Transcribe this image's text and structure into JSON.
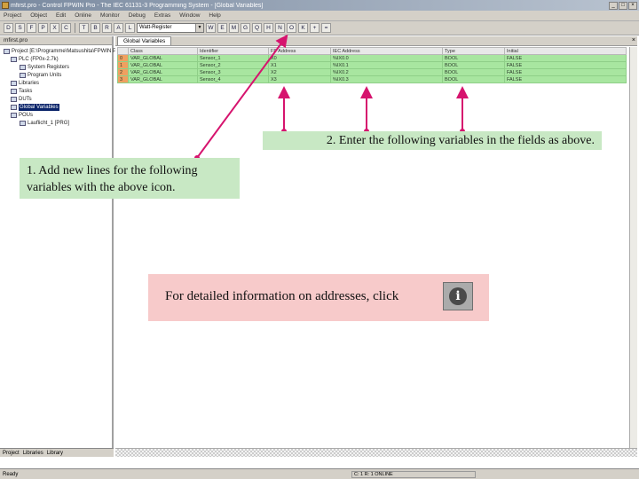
{
  "window": {
    "title": "mfirst.pro - Control FPWIN Pro - The IEC 61131-3 Programming System - [Global Variables]",
    "buttons": [
      "_",
      "□",
      "×"
    ]
  },
  "menu": [
    "Project",
    "Object",
    "Edit",
    "Online",
    "Monitor",
    "Debug",
    "Extras",
    "Window",
    "Help"
  ],
  "toolbar": {
    "buttons_left": [
      "D",
      "S",
      "F",
      "P",
      "X",
      "C"
    ],
    "buttons_mid": [
      "T",
      "B",
      "R",
      "A",
      "L"
    ],
    "combo_value": "Watt-Register",
    "buttons_right": [
      "W",
      "E",
      "M",
      "G",
      "Q",
      "H",
      "N",
      "O",
      "K",
      "+",
      "="
    ]
  },
  "tree": {
    "header": "mfirst.pro",
    "items": [
      {
        "label": "Project [E:\\Programme\\Matsushita\\FPWIN Pro\\Examples\\mfirst.pro]",
        "selected": false
      },
      {
        "label": "PLC (FP0x-2.7k)",
        "selected": false
      },
      {
        "label": "System Registers",
        "selected": false
      },
      {
        "label": "Program Units",
        "selected": false
      },
      {
        "label": "Libraries",
        "selected": false
      },
      {
        "label": "Tasks",
        "selected": false
      },
      {
        "label": "DUTs",
        "selected": false
      },
      {
        "label": "Global Variables",
        "selected": true
      },
      {
        "label": "POUs",
        "selected": false
      },
      {
        "label": "Lauflicht_1 [PRG]",
        "selected": false
      }
    ],
    "tabs": [
      "Project",
      "Libraries",
      "Library"
    ]
  },
  "document": {
    "tab": "Global Variables",
    "columns": [
      "",
      "Class",
      "Identifier",
      "FP Address",
      "IEC Address",
      "Type",
      "Initial"
    ],
    "rows": [
      [
        "0",
        "VAR_GLOBAL",
        "Sensor_1",
        "X0",
        "%IX0.0",
        "BOOL",
        "FALSE"
      ],
      [
        "1",
        "VAR_GLOBAL",
        "Sensor_2",
        "X1",
        "%IX0.1",
        "BOOL",
        "FALSE"
      ],
      [
        "2",
        "VAR_GLOBAL",
        "Sensor_3",
        "X2",
        "%IX0.2",
        "BOOL",
        "FALSE"
      ],
      [
        "3",
        "VAR_GLOBAL",
        "Sensor_4",
        "X3",
        "%IX0.3",
        "BOOL",
        "FALSE"
      ]
    ]
  },
  "status": {
    "left": "Ready",
    "right": "C: 1 R: 1  ONLINE"
  },
  "annotations": {
    "step1": "1. Add new lines for the following variables with the above icon.",
    "step2": "2. Enter the following variables in the  fields as above.",
    "info": "For detailed information on addresses, click",
    "arrow_color": "#d6146e"
  }
}
